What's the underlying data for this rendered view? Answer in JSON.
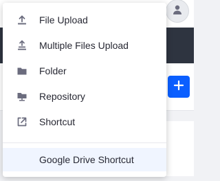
{
  "menu": {
    "items": [
      {
        "label": "File Upload",
        "icon": "upload-icon"
      },
      {
        "label": "Multiple Files Upload",
        "icon": "multi-upload-icon"
      },
      {
        "label": "Folder",
        "icon": "folder-icon"
      },
      {
        "label": "Repository",
        "icon": "repository-icon"
      },
      {
        "label": "Shortcut",
        "icon": "shortcut-icon"
      }
    ],
    "highlighted": {
      "label": "Google Drive Shortcut"
    }
  },
  "colors": {
    "accent": "#0b5fff",
    "text": "#272833",
    "icon": "#6b6c7e",
    "header_dark": "#2e3440",
    "highlight_bg": "#f0f5ff"
  }
}
